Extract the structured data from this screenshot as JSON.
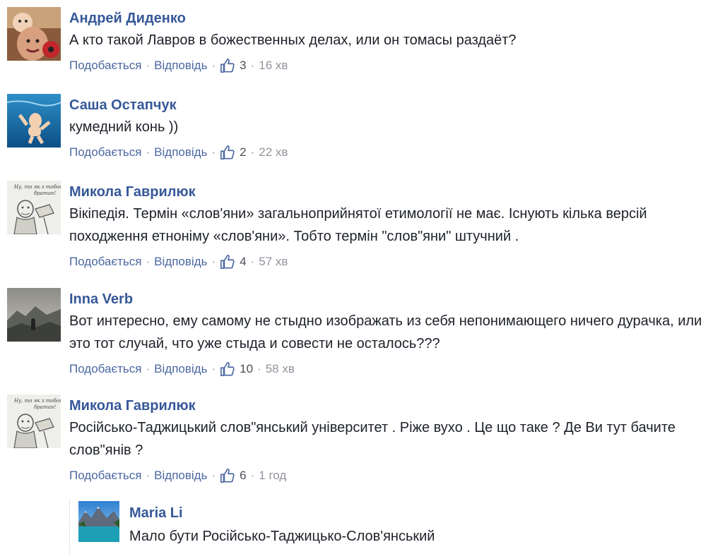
{
  "actions": {
    "like_label": "Подобається",
    "reply_label": "Відповідь",
    "separator": "·"
  },
  "comments": [
    {
      "author": "Андрей Диденко",
      "text": "А кто такой Лавров в божественных делах, или он томасы раздаёт?",
      "likes": "3",
      "time": "16 хв",
      "avatar_icon": "man-with-baby-avatar"
    },
    {
      "author": "Саша Остапчук",
      "text": "кумедний конь ))",
      "likes": "2",
      "time": "22 хв",
      "avatar_icon": "swimming-baby-avatar"
    },
    {
      "author": "Микола Гаврилюк",
      "text": "Вікіпедія. Термін «слов'яни» загальноприйнятої етимології не має. Існують кілька версій походження етноніму «слов'яни». Тобто термін \"слов\"яни\" штучний .",
      "likes": "4",
      "time": "57 хв",
      "avatar_icon": "cartoon-sketch-avatar",
      "avatar_caption": "Ну, то як з тобой, братан!"
    },
    {
      "author": "Inna Verb",
      "text": "Вот интересно, ему самому не стыдно изображать из себя непонимающего ничего дурачка, или это тот случай, что уже стыда и совести не осталось???",
      "likes": "10",
      "time": "58 хв",
      "avatar_icon": "mountain-landscape-avatar"
    },
    {
      "author": "Микола Гаврилюк",
      "text": "Російсько-Таджицький слов\"янський університет . Ріже вухо . Це що таке ? Де Ви тут бачите слов\"янів ?",
      "likes": "6",
      "time": "1 год",
      "avatar_icon": "cartoon-sketch-avatar",
      "avatar_caption": "Ну, то як з тобой, братан!"
    }
  ],
  "reply": {
    "author": "Maria Li",
    "text": "Мало бути Російсько-Таджицько-Слов'янський",
    "avatar_icon": "lake-mountains-avatar"
  },
  "colors": {
    "author": "#365899",
    "link": "#4b67a1",
    "text": "#1d2129",
    "meta": "#90949c"
  }
}
